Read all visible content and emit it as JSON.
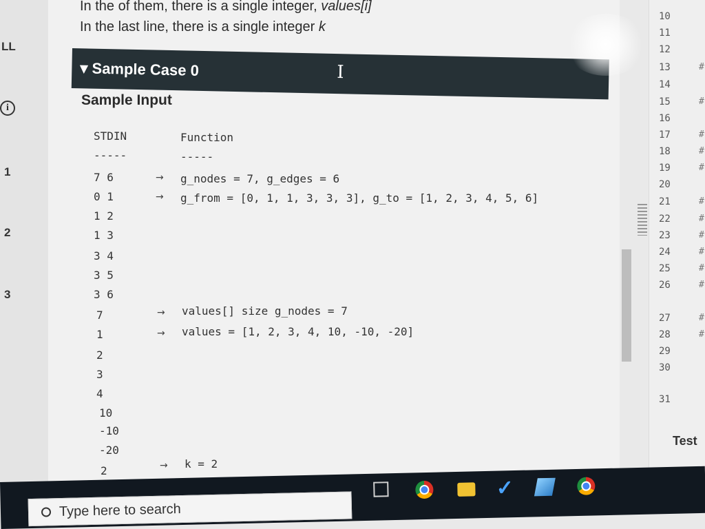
{
  "left_rail": {
    "title": "LL",
    "numbers": [
      "1",
      "2",
      "3"
    ]
  },
  "intro": {
    "line1_a": "In the",
    "line1_b": "of them, there is a single integer,",
    "line1_c": "values[i]",
    "line2_a": "In the last line, there is a single integer",
    "line2_b": "k"
  },
  "sample_case": {
    "title": "▾ Sample Case 0",
    "input_label": "Sample Input"
  },
  "code": {
    "stdin_header": "STDIN",
    "function_header": "Function",
    "dashes_stdin": "-----",
    "dashes_function": "-----",
    "stdin_lines": [
      "7 6",
      "0 1",
      "1 2",
      "1 3",
      "3 4",
      "3 5",
      "3 6",
      "7",
      "1",
      "2",
      "3",
      "4",
      "10",
      "-10",
      "-20",
      "2"
    ],
    "annotations": [
      "g_nodes = 7, g_edges = 6",
      "g_from = [0, 1, 1, 3, 3, 3], g_to = [1, 2, 3, 4, 5, 6]",
      "values[] size g_nodes = 7",
      "values = [1, 2, 3, 4, 10, -10, -20]",
      "k = 2"
    ],
    "arrow": "→"
  },
  "right_panel": {
    "line_numbers": [
      "10",
      "11",
      "12",
      "13",
      "14",
      "15",
      "16",
      "17",
      "18",
      "19",
      "20",
      "21",
      "22",
      "23",
      "24",
      "25",
      "26",
      "27",
      "28",
      "29",
      "30",
      "31"
    ],
    "marker": "#",
    "test_label": "Test"
  },
  "taskbar": {
    "search_placeholder": "Type here to search"
  },
  "icons": [
    "info-icon",
    "text-cursor-icon",
    "search-icon",
    "task-view-icon",
    "chrome-icon",
    "folder-icon",
    "check-icon",
    "notes-icon",
    "chrome-icon"
  ]
}
